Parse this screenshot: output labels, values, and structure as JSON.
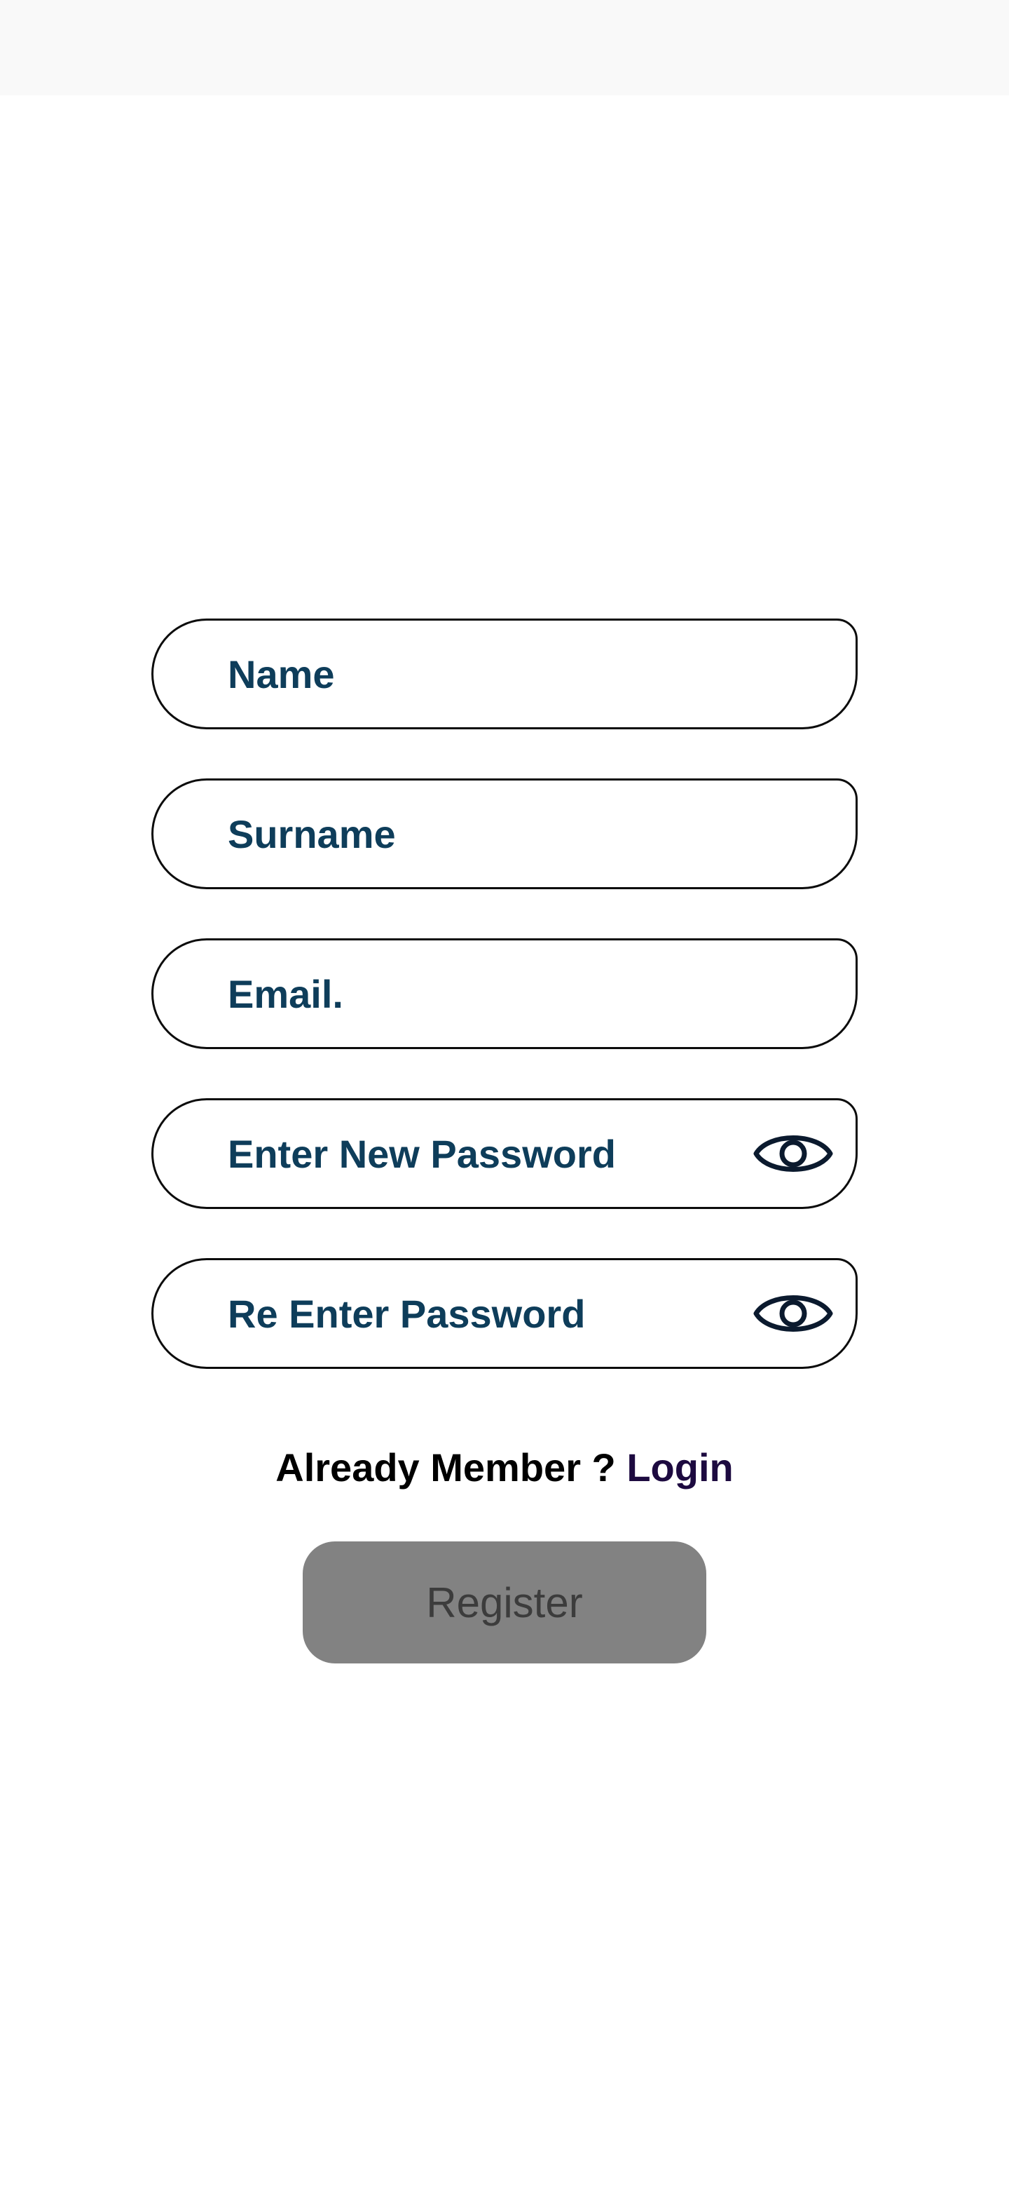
{
  "form": {
    "name_placeholder": "Name",
    "surname_placeholder": "Surname",
    "email_placeholder": "Email.",
    "new_password_placeholder": "Enter New Password",
    "re_password_placeholder": "Re Enter Password",
    "eye_icon": "eye-icon"
  },
  "footer": {
    "member_text": "Already Member ?",
    "login_label": "Login"
  },
  "actions": {
    "register_label": "Register"
  },
  "colors": {
    "field_text": "#0e3d5a",
    "login_link": "#1d0a40",
    "register_bg": "#828282",
    "register_text": "#3c3c3c"
  }
}
